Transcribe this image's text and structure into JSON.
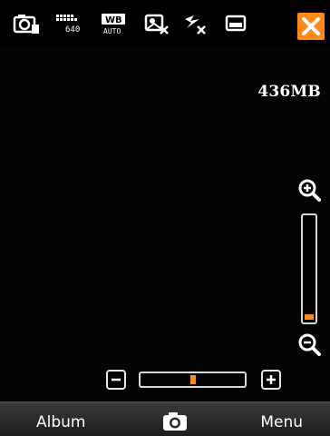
{
  "status_bar": {
    "icons": [
      "camera-mode-icon",
      "resolution-640-icon",
      "white-balance-auto-icon",
      "effects-off-icon",
      "flash-off-icon",
      "storage-card-icon"
    ],
    "resolution_label": "640",
    "wb_label": "WB",
    "wb_sub_label": "AUTO",
    "close_icon": "close-icon"
  },
  "storage": {
    "free_space": "436MB"
  },
  "zoom": {
    "in_icon": "zoom-in-icon",
    "out_icon": "zoom-out-icon",
    "level_fraction": 0.0
  },
  "exposure": {
    "minus_icon": "minus-icon",
    "plus_icon": "plus-icon",
    "value_fraction": 0.5
  },
  "softkeys": {
    "left": "Album",
    "center_icon": "shutter-camera-icon",
    "right": "Menu"
  },
  "colors": {
    "accent": "#ff8a1a",
    "background": "#000000",
    "softkey_bar": "#2a2a2a"
  }
}
